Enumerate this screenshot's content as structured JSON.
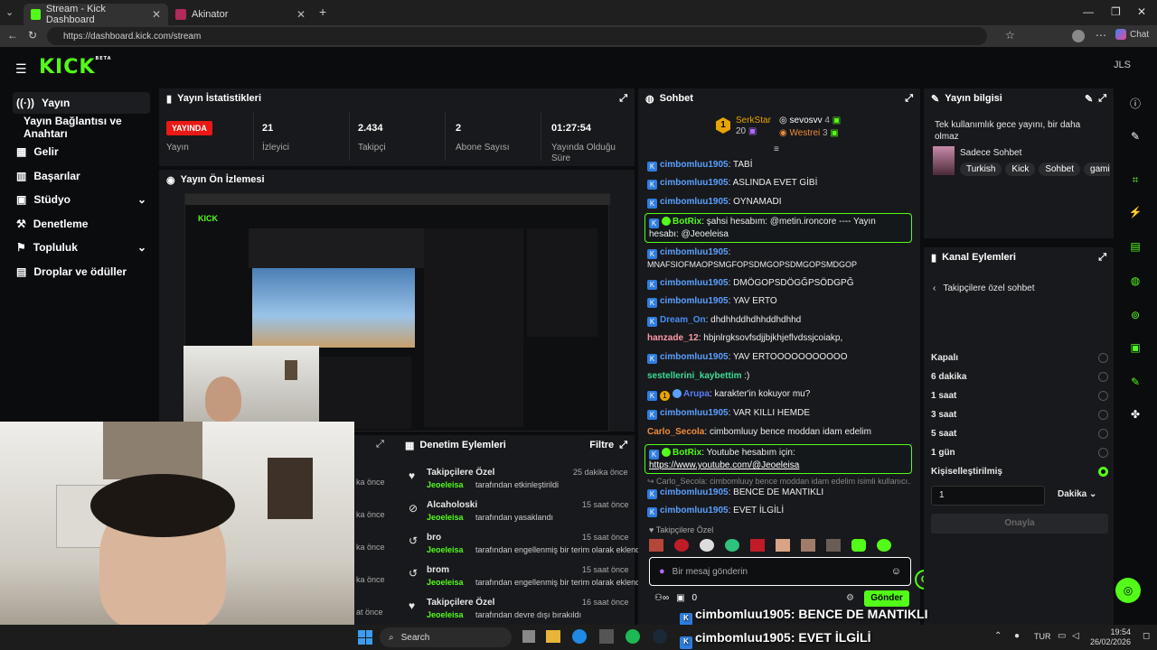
{
  "browser": {
    "tabs": [
      {
        "label": "Stream - Kick Dashboard"
      },
      {
        "label": "Akinator"
      }
    ],
    "url": "https://dashboard.kick.com/stream",
    "chat_button": "Chat"
  },
  "app": {
    "logo": "KICK",
    "logo_beta": "BETA",
    "user_initials": "JLS",
    "sidebar": [
      {
        "label": "Yayın"
      },
      {
        "label": "Yayın Bağlantısı ve Anahtarı"
      },
      {
        "label": "Gelir"
      },
      {
        "label": "Başarılar"
      },
      {
        "label": "Stüdyo"
      },
      {
        "label": "Denetleme"
      },
      {
        "label": "Topluluk"
      },
      {
        "label": "Droplar ve ödüller"
      }
    ],
    "stats": {
      "title": "Yayın İstatistikleri",
      "live_badge": "YAYINDA",
      "live_label": "Yayın",
      "items": [
        {
          "value": "21",
          "label": "İzleyici"
        },
        {
          "value": "2.434",
          "label": "Takipçi"
        },
        {
          "value": "2",
          "label": "Abone Sayısı"
        },
        {
          "value": "01:27:54",
          "label": "Yayında Olduğu Süre"
        }
      ]
    },
    "preview": {
      "title": "Yayın Ön İzlemesi"
    },
    "mod_actions": {
      "title": "Denetim Eylemleri",
      "filter": "Filtre",
      "rows": [
        {
          "title": "Takipçilere Özel",
          "user": "Jeoeleisa",
          "desc": "tarafından etkinleştirildi",
          "time": "25 dakika önce"
        },
        {
          "title": "Alcaholoski",
          "user": "Jeoeleisa",
          "desc": "tarafından yasaklandı",
          "time": "15 saat önce"
        },
        {
          "title": "bro",
          "user": "Jeoeleisa",
          "desc": "tarafından engellenmiş bir terim olarak eklendi",
          "time": "15 saat önce"
        },
        {
          "title": "brom",
          "user": "Jeoeleisa",
          "desc": "tarafından engellenmiş bir terim olarak eklendi",
          "time": "15 saat önce"
        },
        {
          "title": "Takipçilere Özel",
          "user": "Jeoeleisa",
          "desc": "tarafından devre dışı bırakıldı",
          "time": "16 saat önce"
        }
      ],
      "left_times": [
        "ka önce",
        "ka önce",
        "ka önce",
        "ka önce",
        "at önce"
      ]
    },
    "chat": {
      "title": "Sohbet",
      "leaderboard": [
        {
          "rank": "1",
          "name": "SerkStar",
          "count": "20"
        },
        {
          "name": "sevosvv",
          "count": "4"
        },
        {
          "name": "Westrei",
          "count": "3"
        }
      ],
      "messages": [
        {
          "user": "cimbomluu1905",
          "text": "TABİ"
        },
        {
          "user": "cimbomluu1905",
          "text": "ASLINDA EVET GİBİ"
        },
        {
          "user": "cimbomluu1905",
          "text": "OYNAMADI"
        },
        {
          "user": "BotRix",
          "text": "şahsi hesabım: @metin.ironcore ---- Yayın hesabı: @Jeoeleisa"
        },
        {
          "user": "cimbomluu1905",
          "text": "MNAFSIOFMAOPSMGFOPSDMGOPSDMGOPSMDGOP"
        },
        {
          "user": "cimbomluu1905",
          "text": "DMÖGOPSDÖGĞPSÖDGPĞ"
        },
        {
          "user": "cimbomluu1905",
          "text": "YAV ERTO"
        },
        {
          "user": "Dream_On",
          "text": "dhdhhddhdhhddhdhhd"
        },
        {
          "user": "hanzade_12",
          "text": "hbjnlrgksovfsdjjbjkhjeflvdssjcoiakp,"
        },
        {
          "user": "cimbomluu1905",
          "text": "YAV ERTOOOOOOOOOOO"
        },
        {
          "user": "sestellerini_kaybettim",
          "text": ":)"
        },
        {
          "user": "Arupa",
          "text": "karakter'in kokuyor mu?"
        },
        {
          "user": "cimbomluu1905",
          "text": "VAR KILLI HEMDE"
        },
        {
          "user": "Carlo_Secola",
          "text": "cimbomluuy bence moddan idam edelim"
        },
        {
          "user": "BotRix",
          "text": "Youtube hesabım için:",
          "link": "https://www.youtube.com/@Jeoeleisa"
        },
        {
          "user": "Carlo_Secola",
          "text": "cimbomluuy bence moddan idam edelim isimli kullanıcı..."
        },
        {
          "user": "cimbomluu1905",
          "text": "BENCE DE MANTIKLI"
        },
        {
          "user": "cimbomluu1905",
          "text": "EVET İLGİLİ"
        }
      ],
      "followers_only": "Takipçilere Özel",
      "input_placeholder": "Bir mesaj gönderin",
      "send": "Gönder",
      "points": "0"
    },
    "stream_info": {
      "title": "Yayın bilgisi",
      "stream_title": "Tek kullanımlık gece yayını, bir daha olmaz",
      "category": "Sadece Sohbet",
      "tags": [
        "Turkish",
        "Kick",
        "Sohbet",
        "gami"
      ]
    },
    "channel_actions": {
      "title": "Kanal Eylemleri",
      "subtitle": "Takipçilere özel sohbet",
      "options": [
        {
          "label": "Kapalı",
          "selected": false
        },
        {
          "label": "6 dakika",
          "selected": false
        },
        {
          "label": "1 saat",
          "selected": false
        },
        {
          "label": "3 saat",
          "selected": false
        },
        {
          "label": "5 saat",
          "selected": false
        },
        {
          "label": "1 gün",
          "selected": false
        },
        {
          "label": "Kişiselleştirilmiş",
          "selected": true
        }
      ],
      "custom_value": "1",
      "unit": "Dakika",
      "confirm": "Onayla"
    },
    "overlay_captions": [
      {
        "user": "cimbomluu1905",
        "text": ": BENCE DE MANTIKLI"
      },
      {
        "user": "cimbomluu1905",
        "text": ": EVET İLGİLİ"
      }
    ]
  },
  "taskbar": {
    "search": "Search",
    "lang": "TUR",
    "time": "19:54",
    "date": "26/02/2026"
  }
}
